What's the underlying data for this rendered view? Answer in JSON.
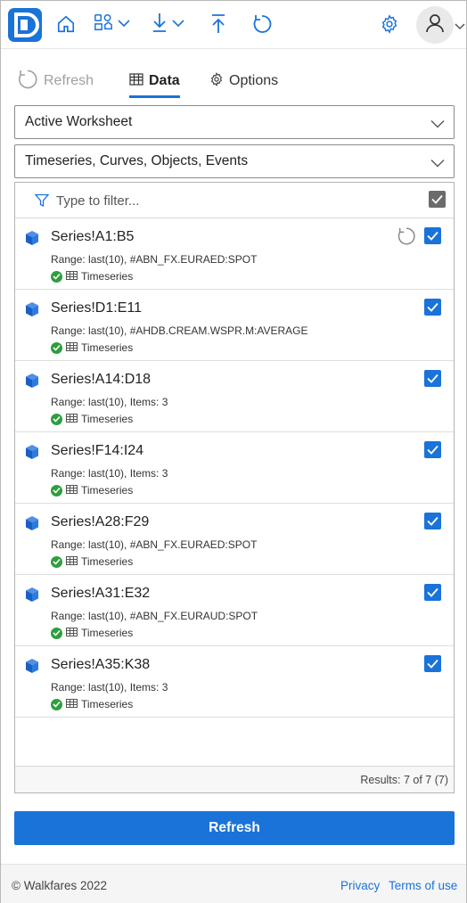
{
  "colors": {
    "accent": "#1a73d9",
    "success": "#2e9e3e",
    "muted": "#a0a0a0"
  },
  "header": {
    "icons": [
      "logo-icon",
      "home-icon",
      "data-sources-icon",
      "download-icon",
      "upload-icon",
      "refresh-icon",
      "settings-icon",
      "user-icon"
    ]
  },
  "tabs": [
    {
      "label": "Refresh",
      "icon": "refresh-icon",
      "state": "disabled"
    },
    {
      "label": "Data",
      "icon": "table-icon",
      "state": "active"
    },
    {
      "label": "Options",
      "icon": "gear-icon",
      "state": "normal"
    }
  ],
  "scope_select": {
    "value": "Active Worksheet"
  },
  "type_select": {
    "value": "Timeseries, Curves, Objects, Events"
  },
  "filter": {
    "placeholder": "Type to filter..."
  },
  "items": [
    {
      "title": "Series!A1:B5",
      "range": "Range: last(10), #ABN_FX.EURAED:SPOT",
      "type": "Timeseries",
      "checked": true,
      "refreshing": true
    },
    {
      "title": "Series!D1:E11",
      "range": "Range: last(10), #AHDB.CREAM.WSPR.M:AVERAGE",
      "type": "Timeseries",
      "checked": true
    },
    {
      "title": "Series!A14:D18",
      "range": "Range: last(10), Items: 3",
      "type": "Timeseries",
      "checked": true
    },
    {
      "title": "Series!F14:I24",
      "range": "Range: last(10), Items: 3",
      "type": "Timeseries",
      "checked": true
    },
    {
      "title": "Series!A28:F29",
      "range": "Range: last(10), #ABN_FX.EURAED:SPOT",
      "type": "Timeseries",
      "checked": true
    },
    {
      "title": "Series!A31:E32",
      "range": "Range: last(10), #ABN_FX.EURAUD:SPOT",
      "type": "Timeseries",
      "checked": true
    },
    {
      "title": "Series!A35:K38",
      "range": "Range: last(10), Items: 3",
      "type": "Timeseries",
      "checked": true
    }
  ],
  "results": "Results: 7 of 7 (7)",
  "refresh_button": "Refresh",
  "footer": {
    "copyright": "© Walkfares 2022",
    "privacy": "Privacy",
    "terms": "Terms of use"
  }
}
